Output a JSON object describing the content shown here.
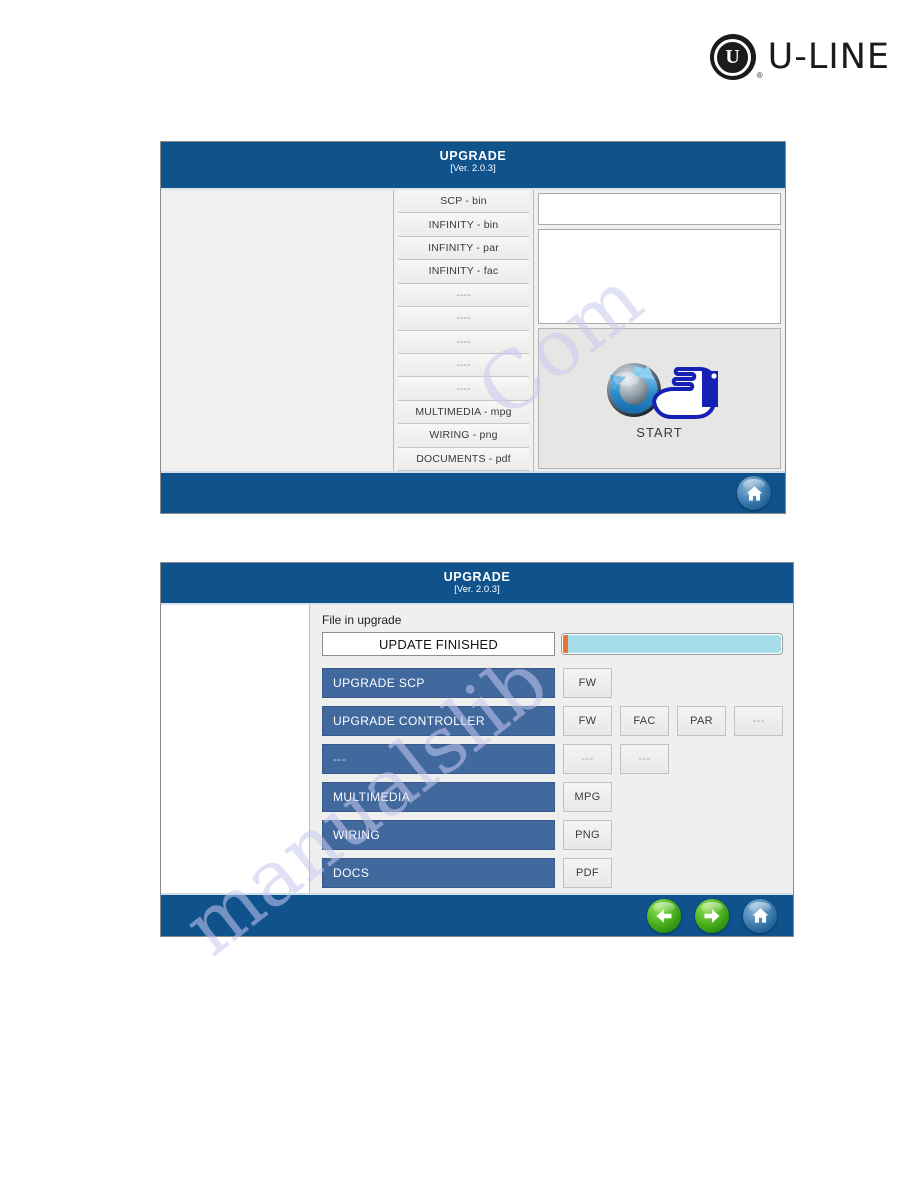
{
  "brand": {
    "logo_letter": "U",
    "logo_registered": "®",
    "name": "U-LINE"
  },
  "watermark": {
    "text_a": "Com",
    "text_b": "manualslib"
  },
  "panel1": {
    "title": "UPGRADE",
    "version": "[Ver. 2.0.3]",
    "file_list": [
      "SCP - bin",
      "INFINITY - bin",
      "INFINITY - par",
      "INFINITY - fac",
      "----",
      "----",
      "----",
      "----",
      "----",
      "MULTIMEDIA - mpg",
      "WIRING - png",
      "DOCUMENTS - pdf"
    ],
    "start_label": "START",
    "home_icon": "home-icon",
    "start_icon": "refresh-circle-icon",
    "cursor_icon": "pointing-hand-icon"
  },
  "panel2": {
    "title": "UPGRADE",
    "version": "[Ver. 2.0.3]",
    "file_in_upgrade_label": "File in upgrade",
    "status": "UPDATE FINISHED",
    "progress_percent": 100,
    "rows": [
      {
        "name": "UPGRADE SCP",
        "tags": [
          "FW"
        ]
      },
      {
        "name": "UPGRADE CONTROLLER",
        "tags": [
          "FW",
          "FAC",
          "PAR",
          "---"
        ]
      },
      {
        "name": "---",
        "tags": [
          "---",
          "---"
        ]
      },
      {
        "name": "MULTIMEDIA",
        "tags": [
          "MPG"
        ]
      },
      {
        "name": "WIRING",
        "tags": [
          "PNG"
        ]
      },
      {
        "name": "DOCS",
        "tags": [
          "PDF"
        ]
      }
    ],
    "nav": {
      "back_icon": "arrow-left-icon",
      "forward_icon": "arrow-right-icon",
      "home_icon": "home-icon"
    }
  },
  "colors": {
    "header_blue": "#10538c",
    "row_blue": "#41699d",
    "progress_fill": "#a6dde9",
    "progress_start": "#e8722e",
    "green_button": "#4fb520"
  }
}
